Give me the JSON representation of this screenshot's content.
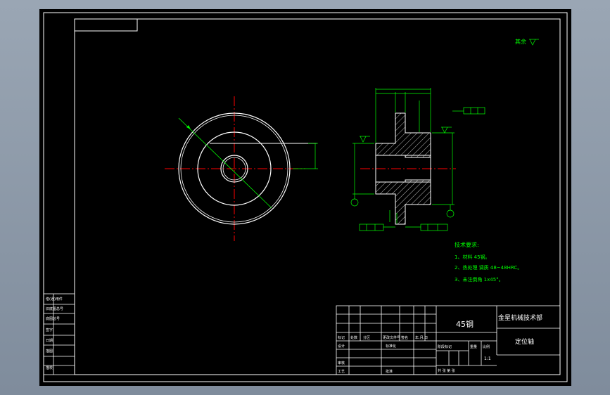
{
  "notes": {
    "header": "技术要求:",
    "line1": "1、材料 45钢。",
    "line2": "2、热处理 调质 48~48HRC。",
    "line3": "3、未注倒角 1x45°。"
  },
  "title_block": {
    "material": "45钢",
    "company": "金星机械技术部",
    "part_name": "定位轴",
    "scale": "1:1",
    "row_labels": [
      "标记",
      "处数",
      "分区",
      "更改文件号",
      "签名",
      "年.月.日"
    ],
    "designer": "设计",
    "standardization": "标准化",
    "review": "审核",
    "process": "工艺",
    "approve": "批准",
    "stage_mark": "阶段标记",
    "weight": "重量",
    "ratio": "比例",
    "sheets": "共 张 第 张"
  },
  "side_block": {
    "labels": [
      "借(通)用件",
      "旧底图总号",
      "底图总号",
      "签字",
      "日期",
      "描图",
      "描校"
    ]
  },
  "roughness_note": "其余",
  "colors": {
    "background": "#000000",
    "line": "#ffffff",
    "dimension": "#00ff00",
    "center": "#ff0000"
  }
}
